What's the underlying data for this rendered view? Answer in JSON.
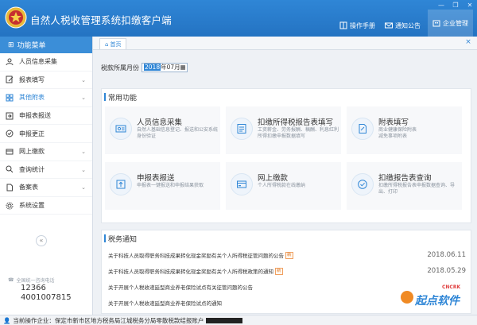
{
  "app": {
    "title": "自然人税收管理系统扣缴客户端",
    "top_buttons": [
      {
        "label": "操作手册",
        "icon": "book-icon"
      },
      {
        "label": "通知公告",
        "icon": "mail-icon"
      },
      {
        "label": "企业管理",
        "icon": "building-icon"
      }
    ],
    "accent_color": "#2f86d6"
  },
  "sidebar": {
    "header": "功能菜单",
    "items": [
      {
        "label": "人员信息采集",
        "icon": "person-icon"
      },
      {
        "label": "报表填写",
        "icon": "edit-icon",
        "expandable": true
      },
      {
        "label": "其他附表",
        "icon": "grid-icon",
        "expandable": true,
        "active": true
      },
      {
        "label": "申报表报送",
        "icon": "send-icon"
      },
      {
        "label": "申报更正",
        "icon": "correct-icon"
      },
      {
        "label": "网上缴款",
        "icon": "payment-icon",
        "expandable": true
      },
      {
        "label": "查询统计",
        "icon": "search-icon",
        "expandable": true
      },
      {
        "label": "备案表",
        "icon": "file-icon",
        "expandable": true
      },
      {
        "label": "系统设置",
        "icon": "gear-icon"
      }
    ],
    "collapse_glyph": "«",
    "hotline_label": "全国统一咨询电话",
    "hotline_numbers": [
      "12366",
      "4001007815"
    ]
  },
  "tabs": {
    "home_label": "首页",
    "close_glyph": "×"
  },
  "period": {
    "label": "税款所属月份",
    "year_selected": "2018",
    "month_part": "年07月"
  },
  "common": {
    "title": "常用功能",
    "items": [
      {
        "title": "人员信息采集",
        "desc": "自然人基础信息登记、报送和公安系统身份验证",
        "icon": "user-card-icon"
      },
      {
        "title": "扣缴所得税报告表填写",
        "desc": "工资薪金、劳务报酬、稿酬、利息红利所得扣缴申报数据填写",
        "icon": "form-icon"
      },
      {
        "title": "附表填写",
        "desc": "商业健康保险附表\n减免事项附表",
        "icon": "attachment-icon"
      },
      {
        "title": "申报表报送",
        "desc": "申报表一键报送和申报结果获取",
        "icon": "upload-icon"
      },
      {
        "title": "网上缴款",
        "desc": "个人所得税款在线缴纳",
        "icon": "card-icon"
      },
      {
        "title": "扣缴报告表查询",
        "desc": "扣缴所得税报告表申报数据查询、导出、打印",
        "icon": "check-icon"
      }
    ]
  },
  "notices": {
    "title": "税务通知",
    "items": [
      {
        "text": "关于科技人员取得职务科技成果转化现金奖励有关个人所得税征管问题的公告",
        "new": true,
        "date": "2018.06.11"
      },
      {
        "text": "关于科技人员取得职务科技成果转化现金奖励有关个人所得税政策的通知",
        "new": true,
        "date": "2018.05.29"
      },
      {
        "text": "关于开展个人税收递延型商业养老保险试点有关征管问题的公告",
        "new": false,
        "date": ""
      },
      {
        "text": "关于开展个人税收递延型商业养老保险试点的通知",
        "new": false,
        "date": ""
      }
    ],
    "new_label": "新"
  },
  "status": {
    "text": "当前操作企业：保定市新市区地方税务局江城税务分局零散税款结报账户"
  },
  "watermark": {
    "text": "起点软件",
    "sub": "CNCRK"
  }
}
